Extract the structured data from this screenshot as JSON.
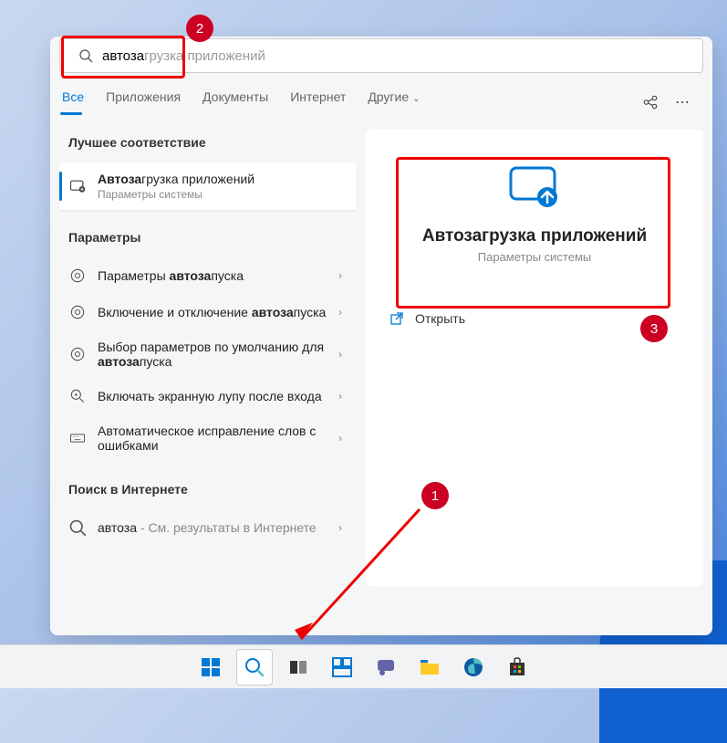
{
  "search": {
    "typed": "автоза",
    "completion": "грузка приложений"
  },
  "tabs": [
    "Все",
    "Приложения",
    "Документы",
    "Интернет",
    "Другие"
  ],
  "left": {
    "best_match_label": "Лучшее соответствие",
    "best_match": {
      "title_bold": "Автоза",
      "title_rest": "грузка приложений",
      "subtitle": "Параметры системы"
    },
    "params_label": "Параметры",
    "params": [
      {
        "pre": "Параметры ",
        "bold": "автоза",
        "post": "пуска"
      },
      {
        "pre": "Включение и отключение ",
        "bold": "автоза",
        "post": "пуска"
      },
      {
        "pre": "Выбор параметров по умолчанию для ",
        "bold": "автоза",
        "post": "пуска"
      },
      {
        "pre": "Включать экранную лупу после входа",
        "bold": "",
        "post": ""
      },
      {
        "pre": "Автоматическое исправление слов с ошибками",
        "bold": "",
        "post": ""
      }
    ],
    "web_label": "Поиск в Интернете",
    "web_item": {
      "term": "автоза",
      "suffix": " - См. результаты в Интернете"
    }
  },
  "right": {
    "title": "Автозагрузка приложений",
    "subtitle": "Параметры системы",
    "open_label": "Открыть"
  },
  "annotations": {
    "b1": "1",
    "b2": "2",
    "b3": "3"
  }
}
